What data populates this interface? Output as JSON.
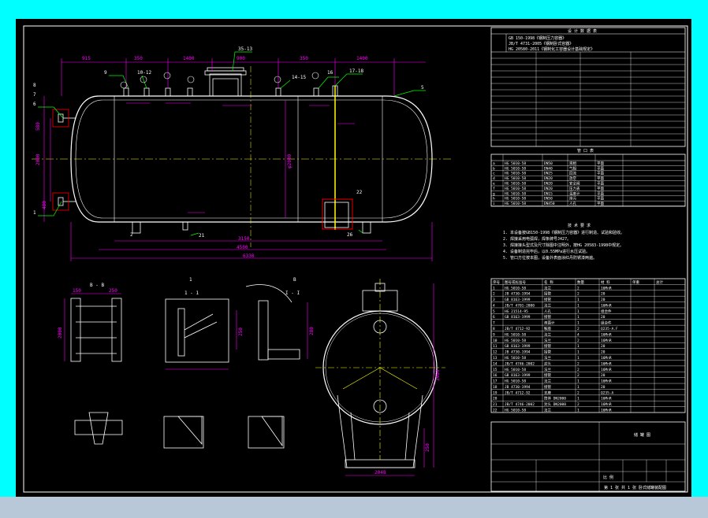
{
  "colors": {
    "background_outer": "#00ffff",
    "canvas": "#000000",
    "strip": "#b8c8d8",
    "border": "#ffffff",
    "vessel": "#ffffff",
    "dimension": "#ff00ff",
    "centerline": "#ffff00",
    "leader": "#00ff00",
    "detail_box": "#ff0000",
    "text": "#ffffff"
  },
  "dimensions": {
    "top": [
      "915",
      "350",
      "1400",
      "900",
      "350",
      "1400"
    ],
    "overall_1": "3150",
    "overall_2": "4500",
    "overall_3": "6330",
    "left_1": "580",
    "left_2": "2000",
    "left_3": "480",
    "vertical_inner": "φ2000",
    "side_height": "3460",
    "side_bottom": "2048",
    "side_small": "250",
    "detail_a_1": "150",
    "detail_a_2": "250",
    "detail_a_h": "2000",
    "detail_b_h": "250",
    "detail_c_h": "280"
  },
  "labels": {
    "nozzle_top_center": "35-13",
    "nozzle_right": "17-18",
    "nozzle_left_a": "10-12",
    "nozzle_mid": "14-15",
    "mark_16": "16",
    "mark_9": "9",
    "mark_8": "8",
    "mark_7": "7",
    "mark_6": "6",
    "mark_5": "5",
    "mark_1": "1",
    "mark_2": "2",
    "mark_21": "21",
    "mark_22": "22",
    "mark_26": "26",
    "section_bb": "B - B",
    "section_11": "1 - 1",
    "section_ii": "I - I",
    "detail_b": "B",
    "detail_1": "1",
    "detail_i": "I"
  },
  "title_block": {
    "header": "设 计 数 据 表",
    "design_line1": "GB 150-1998《钢制压力容器》",
    "design_line2": "JB/T 4731-2005《钢制卧式容器》",
    "design_line3": "HG 20580-2011《钢制化工容器设计基础规定》",
    "notes_title": "技 术 要 求",
    "note1": "1. 本设备按GB150-1998《钢制压力容器》进行制造、试验和验收。",
    "note2": "2. 焊接采用电弧焊，焊条牌号J427。",
    "note3": "3. 焊接接头型式及尺寸除图中注明外，按HG 20583-1998中规定。",
    "note4": "4. 设备制造完毕后，以0.55MPa进行水压试验。",
    "note5": "5. 管口方位按本图，设备外表面涂红丹防锈漆两遍。",
    "company": "储 罐 图",
    "drawing_name": "卧式储罐装配图",
    "scale_label": "比 例",
    "sheet_label": "第 1 张 共 1 张",
    "nozzle_table_title": "管 口 表",
    "parts_header": [
      "序号",
      "图号或标准号",
      "名 称",
      "数量",
      "材 料",
      "单重",
      "总计"
    ]
  },
  "nozzle_table_rows": [
    [
      "a",
      "HG 5010-58",
      "DN50",
      "液相",
      "平面",
      ""
    ],
    [
      "b",
      "HG 5010-58",
      "DN40",
      "气相",
      "平面",
      ""
    ],
    [
      "c",
      "HG 5010-58",
      "DN25",
      "回流",
      "平面",
      ""
    ],
    [
      "d",
      "HG 5010-58",
      "DN20",
      "放空",
      "平面",
      ""
    ],
    [
      "e",
      "HG 5010-58",
      "DN20",
      "安全阀",
      "平面",
      ""
    ],
    [
      "f",
      "HG 5010-58",
      "DN20",
      "压力表",
      "平面",
      ""
    ],
    [
      "g",
      "HG 5010-58",
      "DN15",
      "温度计",
      "平面",
      ""
    ],
    [
      "h",
      "HG 5010-58",
      "DN50",
      "排污",
      "平面",
      ""
    ],
    [
      "i",
      "HG 5010-58",
      "DN450",
      "人孔",
      "平面",
      ""
    ]
  ],
  "parts_rows": [
    [
      "1",
      "HG 5010-58",
      "法兰",
      "2",
      "16MnR"
    ],
    [
      "2",
      "JB 4730-1994",
      "接管",
      "2",
      "20"
    ],
    [
      "3",
      "GB 8163-1999",
      "接管",
      "1",
      "20"
    ],
    [
      "4",
      "JB/T 4701-2000",
      "法兰",
      "1",
      "16MnR"
    ],
    [
      "5",
      "HG 21514-95",
      "人孔",
      "1",
      "组合件"
    ],
    [
      "6",
      "GB 8163-1999",
      "接管",
      "1",
      "20"
    ],
    [
      "7",
      "",
      "液面计",
      "1",
      "组合件"
    ],
    [
      "8",
      "JB/T 4712-92",
      "鞍座",
      "2",
      "Q235-A.F"
    ],
    [
      "9",
      "HG 5010-58",
      "法兰",
      "4",
      "16MnR"
    ],
    [
      "10",
      "HG 5010-58",
      "法兰",
      "2",
      "16MnR"
    ],
    [
      "11",
      "GB 8163-1999",
      "接管",
      "1",
      "20"
    ],
    [
      "12",
      "JB 4730-1994",
      "接管",
      "1",
      "20"
    ],
    [
      "13",
      "HG 5010-58",
      "法兰",
      "1",
      "16MnR"
    ],
    [
      "14",
      "JB/T 4746-2002",
      "封头",
      "2",
      "16MnR"
    ],
    [
      "15",
      "HG 5010-58",
      "法兰",
      "2",
      "16MnR"
    ],
    [
      "16",
      "GB 8163-1999",
      "接管",
      "2",
      "20"
    ],
    [
      "17",
      "HG 5010-58",
      "法兰",
      "1",
      "16MnR"
    ],
    [
      "18",
      "JB 4730-1994",
      "接管",
      "1",
      "20"
    ],
    [
      "19",
      "JB/T 4712-92",
      "支座",
      "2",
      "Q235-A"
    ],
    [
      "20",
      "",
      "筒体 DN2000",
      "1",
      "16MnR"
    ],
    [
      "21",
      "JB/T 4746-2002",
      "封头 DN2000",
      "2",
      "16MnR"
    ],
    [
      "22",
      "HG 5010-58",
      "法兰",
      "1",
      "16MnR"
    ]
  ]
}
